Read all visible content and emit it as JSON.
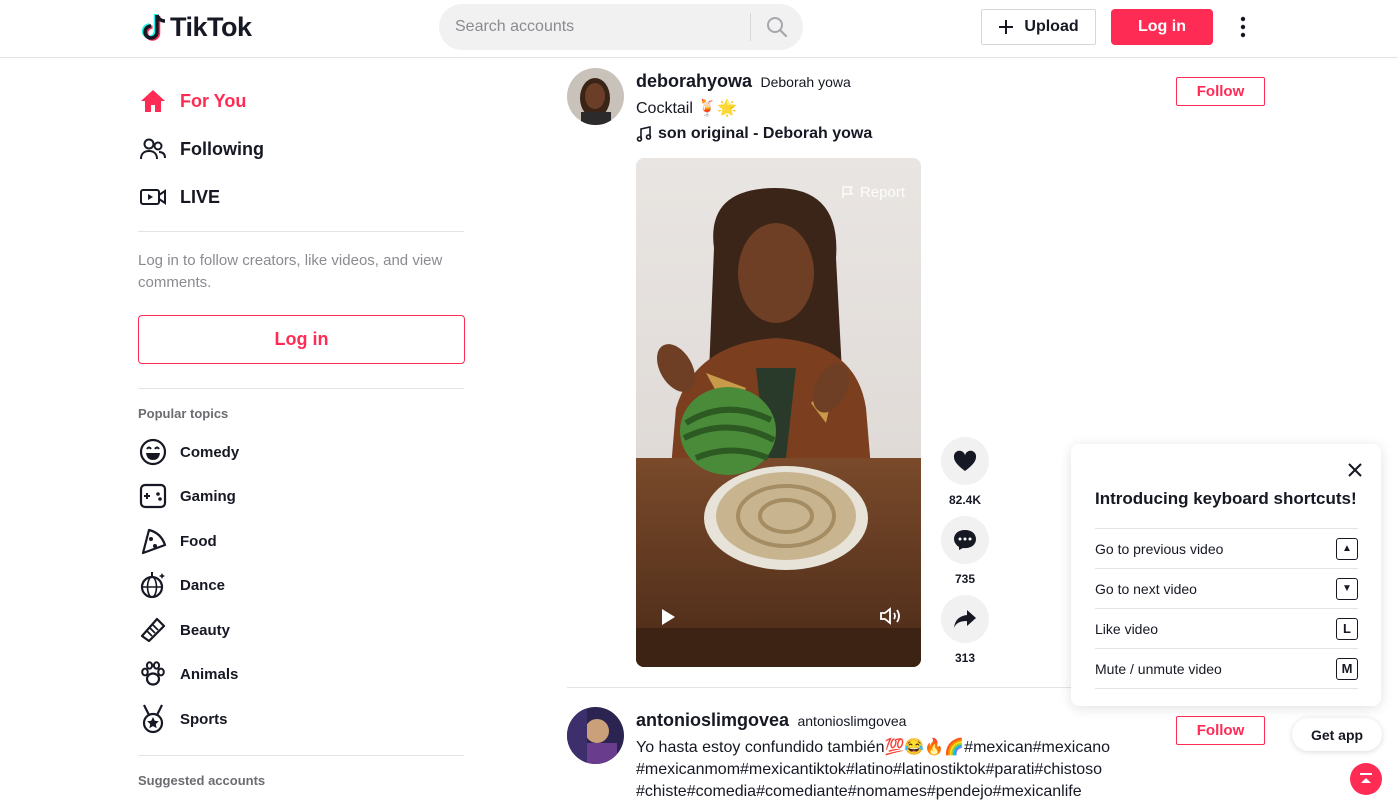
{
  "app": {
    "name": "TikTok"
  },
  "header": {
    "search_placeholder": "Search accounts",
    "upload_label": "Upload",
    "login_label": "Log in"
  },
  "sidebar": {
    "nav": [
      {
        "label": "For You",
        "icon": "home-icon",
        "active": true
      },
      {
        "label": "Following",
        "icon": "users-icon",
        "active": false
      },
      {
        "label": "LIVE",
        "icon": "live-icon",
        "active": false
      }
    ],
    "login_hint": "Log in to follow creators, like videos, and view comments.",
    "login_label": "Log in",
    "popular_title": "Popular topics",
    "topics": [
      {
        "label": "Comedy",
        "icon": "smiley-icon"
      },
      {
        "label": "Gaming",
        "icon": "gamepad-icon"
      },
      {
        "label": "Food",
        "icon": "pizza-icon"
      },
      {
        "label": "Dance",
        "icon": "disco-ball-icon"
      },
      {
        "label": "Beauty",
        "icon": "comb-icon"
      },
      {
        "label": "Animals",
        "icon": "paw-icon"
      },
      {
        "label": "Sports",
        "icon": "medal-icon"
      }
    ],
    "suggested_title": "Suggested accounts"
  },
  "feed": {
    "posts": [
      {
        "author": "deborahyowa",
        "nickname": "Deborah yowa",
        "caption": "Cocktail 🍹🌟",
        "music": "son original - Deborah yowa",
        "follow_label": "Follow",
        "report_label": "Report",
        "likes": "82.4K",
        "comments": "735",
        "shares": "313"
      },
      {
        "author": "antonioslimgovea",
        "nickname": "antonioslimgovea",
        "caption": "Yo hasta estoy confundido también💯😂🔥🌈#mexican#mexicano #mexicanmom#mexicantiktok#latino#latinostiktok#parati#chistoso #chiste#comedia#comediante#nomames#pendejo#mexicanlife",
        "follow_label": "Follow"
      }
    ]
  },
  "shortcuts": {
    "title": "Introducing keyboard shortcuts!",
    "items": [
      {
        "label": "Go to previous video",
        "key": "▲"
      },
      {
        "label": "Go to next video",
        "key": "▼"
      },
      {
        "label": "Like video",
        "key": "L"
      },
      {
        "label": "Mute / unmute video",
        "key": "M"
      }
    ]
  },
  "get_app_label": "Get app",
  "colors": {
    "accent": "#fe2c55",
    "text": "#161823",
    "muted": "#8a8b91"
  }
}
